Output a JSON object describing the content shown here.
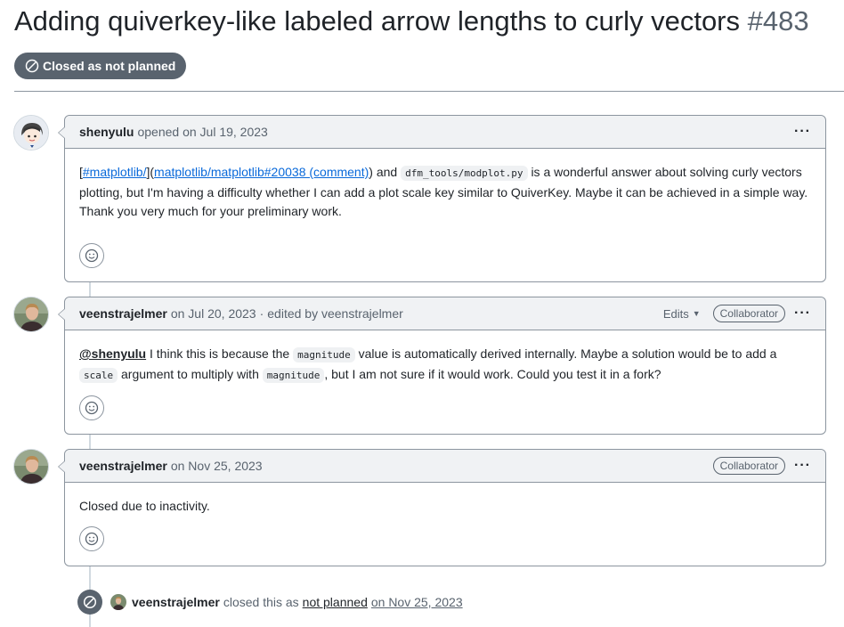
{
  "issue": {
    "title": "Adding quiverkey-like labeled arrow lengths to curly vectors",
    "number": "#483",
    "state": "Closed as not planned"
  },
  "comments": [
    {
      "author": "shenyulu",
      "action": "opened on Jul 19, 2023",
      "body": {
        "link1": "#matplotlib/",
        "link2": "matplotlib/matplotlib#20038 (comment)",
        "t1": "and",
        "code1": "dfm_tools/modplot.py",
        "t2": "is a wonderful answer about solving curly vectors plotting, but I'm having a difficulty whether I can add a plot scale key similar to QuiverKey. Maybe it can be achieved in a simple way. Thank you very much for your preliminary work."
      }
    },
    {
      "author": "veenstrajelmer",
      "date": "on Jul 20, 2023",
      "edited": "edited by veenstrajelmer",
      "edits_label": "Edits",
      "badge": "Collaborator",
      "body": {
        "mention": "@shenyulu",
        "t1": "I think this is because the",
        "code1": "magnitude",
        "t2": "value is automatically derived internally. Maybe a solution would be to add a",
        "code2": "scale",
        "t3": "argument to multiply with",
        "code3": "magnitude",
        "t4": ", but I am not sure if it would work. Could you test it in a fork?"
      }
    },
    {
      "author": "veenstrajelmer",
      "date": "on Nov 25, 2023",
      "badge": "Collaborator",
      "body": {
        "text": "Closed due to inactivity."
      }
    }
  ],
  "event": {
    "author": "veenstrajelmer",
    "text": "closed this as",
    "reason": "not planned",
    "date": "on Nov 25, 2023"
  },
  "kebab": "···",
  "colors": {
    "closed_badge": "#59636e",
    "link": "#0969da",
    "header_bg": "#f0f2f4",
    "border": "#8c959f"
  }
}
